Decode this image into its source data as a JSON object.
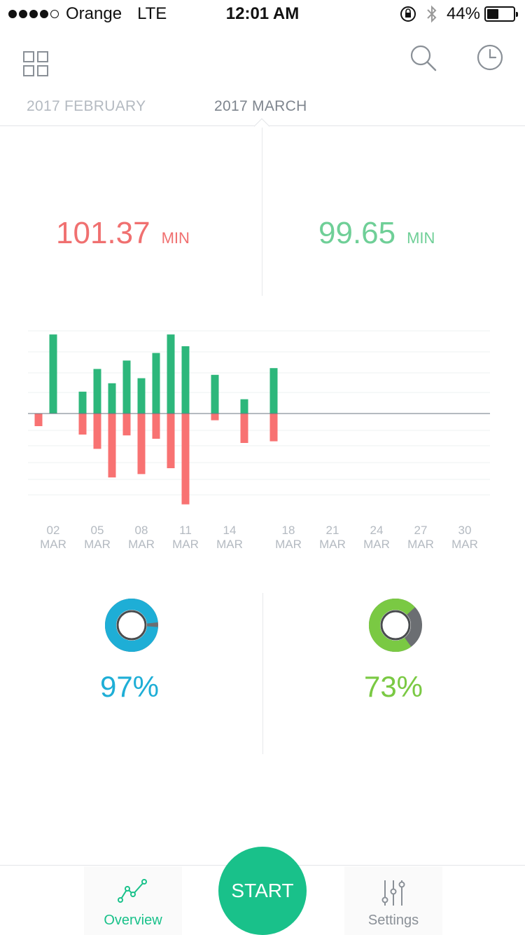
{
  "status_bar": {
    "carrier": "Orange",
    "network": "LTE",
    "time": "12:01 AM",
    "battery": "44%",
    "battery_level": 0.44,
    "signal_bars": 4,
    "signal_total": 5
  },
  "header": {
    "left_icon": "grid-icon",
    "search_icon": "search-icon",
    "history_icon": "clock-icon"
  },
  "tabs": [
    {
      "label": "2017 FEBRUARY",
      "active": false
    },
    {
      "label": "2017 MARCH",
      "active": true
    }
  ],
  "stats": {
    "left": {
      "value": "101.37",
      "unit": "MIN",
      "color": "#f07070"
    },
    "right": {
      "value": "99.65",
      "unit": "MIN",
      "color": "#6fcf97"
    }
  },
  "chart_data": {
    "type": "bar",
    "colors": {
      "positive": "#2db77b",
      "negative": "#f87272",
      "baseline": "#6b7680",
      "grid": "#eef0f2"
    },
    "tick_labels": [
      {
        "day": "02",
        "month": "MAR",
        "date": 2
      },
      {
        "day": "05",
        "month": "MAR",
        "date": 5
      },
      {
        "day": "08",
        "month": "MAR",
        "date": 8
      },
      {
        "day": "11",
        "month": "MAR",
        "date": 11
      },
      {
        "day": "14",
        "month": "MAR",
        "date": 14
      },
      {
        "day": "18",
        "month": "MAR",
        "date": 18
      },
      {
        "day": "21",
        "month": "MAR",
        "date": 21
      },
      {
        "day": "24",
        "month": "MAR",
        "date": 24
      },
      {
        "day": "27",
        "month": "MAR",
        "date": 27
      },
      {
        "day": "30",
        "month": "MAR",
        "date": 30
      }
    ],
    "bars": [
      {
        "date": 1,
        "up": 0,
        "down": 15
      },
      {
        "date": 2,
        "up": 94,
        "down": 0
      },
      {
        "date": 4,
        "up": 26,
        "down": 25
      },
      {
        "date": 5,
        "up": 53,
        "down": 42
      },
      {
        "date": 6,
        "up": 36,
        "down": 76
      },
      {
        "date": 7,
        "up": 63,
        "down": 26
      },
      {
        "date": 8,
        "up": 42,
        "down": 72
      },
      {
        "date": 9,
        "up": 72,
        "down": 30
      },
      {
        "date": 10,
        "up": 94,
        "down": 65
      },
      {
        "date": 11,
        "up": 80,
        "down": 108
      },
      {
        "date": 13,
        "up": 46,
        "down": 8
      },
      {
        "date": 15,
        "up": 17,
        "down": 35
      },
      {
        "date": 17,
        "up": 54,
        "down": 33
      }
    ],
    "ylim": [
      -110,
      100
    ]
  },
  "donuts": [
    {
      "percent": 97,
      "label": "97%",
      "color": "#1eaed6",
      "rest_color": "#6b6e72"
    },
    {
      "percent": 73,
      "label": "73%",
      "color": "#7ac943",
      "rest_color": "#6b6e72"
    }
  ],
  "nav": {
    "overview": {
      "label": "Overview",
      "icon": "line-chart-icon",
      "color": "#19c18a"
    },
    "start": {
      "label": "START"
    },
    "settings": {
      "label": "Settings",
      "icon": "sliders-icon",
      "color": "#8a9097"
    }
  }
}
